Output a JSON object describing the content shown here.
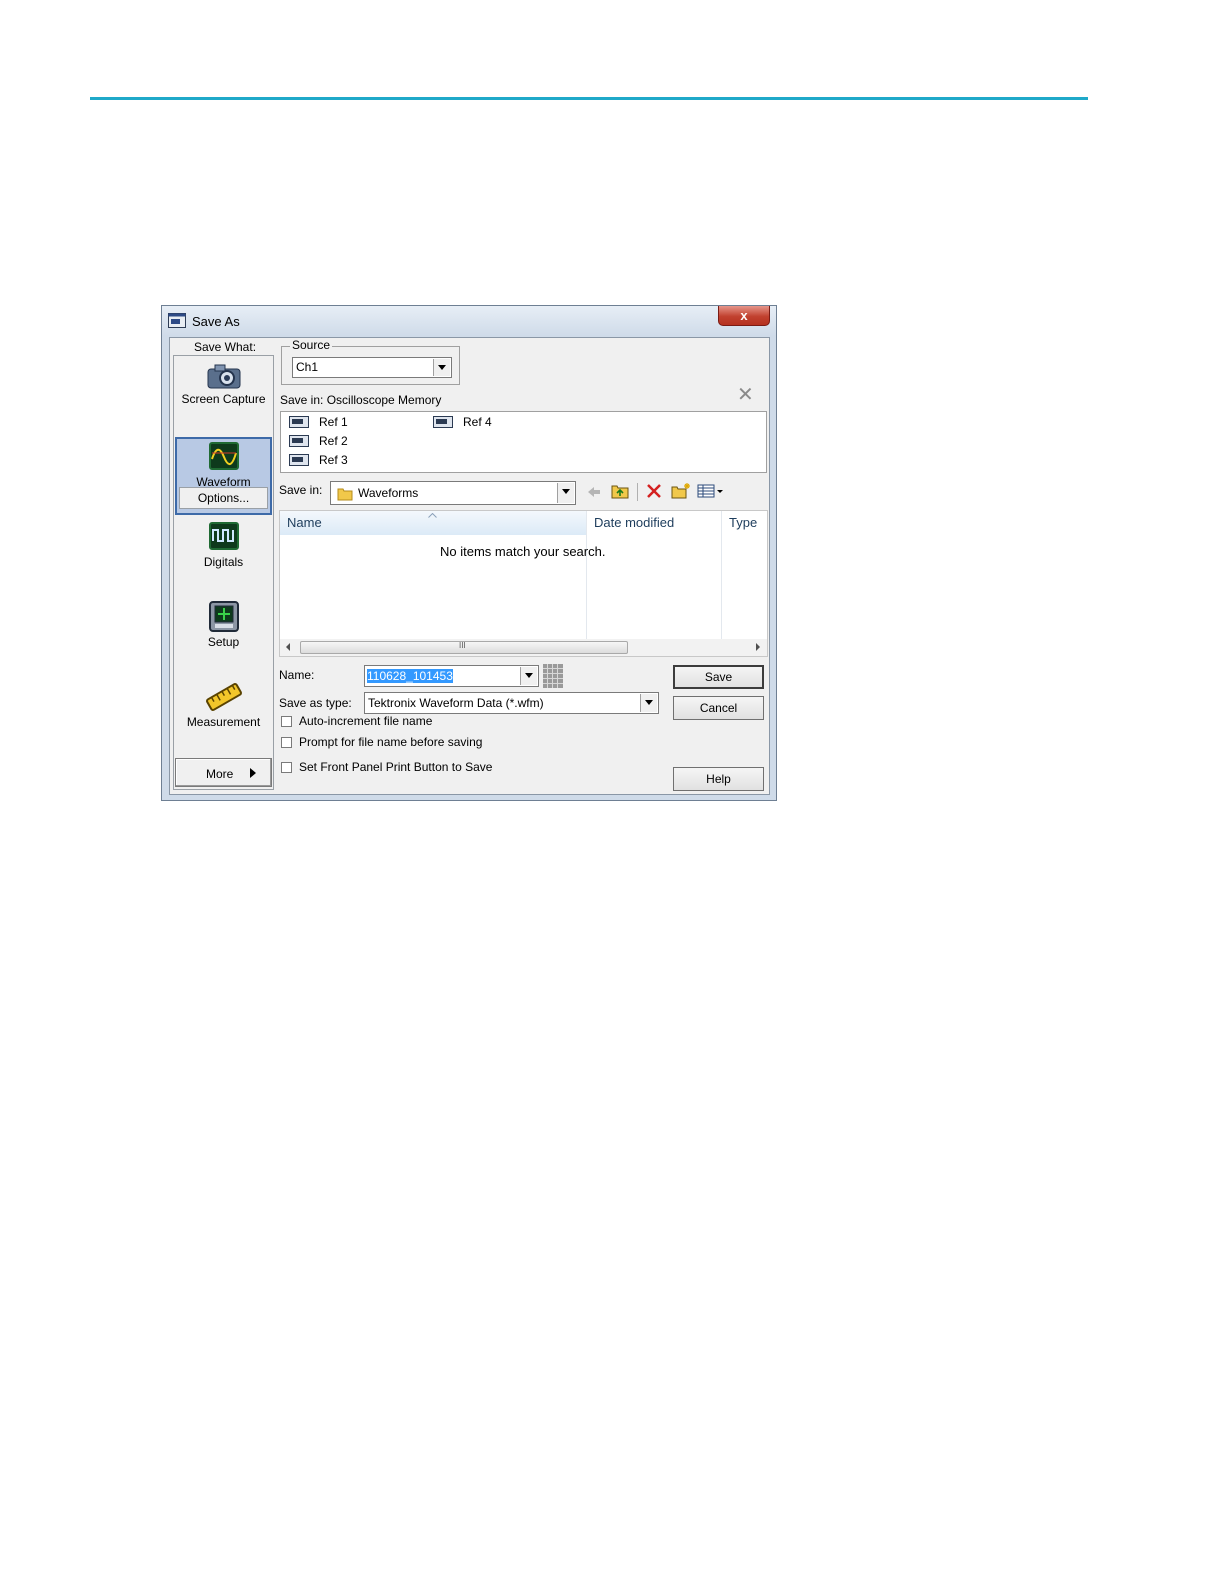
{
  "window": {
    "title": "Save As",
    "close_label": "x"
  },
  "save_what": {
    "label": "Save What:",
    "items": [
      {
        "label": "Screen Capture",
        "icon": "camera-icon"
      },
      {
        "label": "Waveform",
        "icon": "waveform-icon",
        "selected": true
      },
      {
        "label": "Digitals",
        "icon": "digitals-icon"
      },
      {
        "label": "Setup",
        "icon": "setup-icon"
      },
      {
        "label": "Measurement",
        "icon": "measurement-icon"
      }
    ],
    "options_label": "Options...",
    "more_label": "More"
  },
  "source": {
    "label": "Source",
    "value": "Ch1"
  },
  "memory": {
    "label": "Save in: Oscilloscope Memory",
    "refs": [
      "Ref 1",
      "Ref 2",
      "Ref 3",
      "Ref 4"
    ]
  },
  "folder": {
    "label": "Save in:",
    "value": "Waveforms"
  },
  "file_list": {
    "columns": [
      "Name",
      "Date modified",
      "Type"
    ],
    "empty_message": "No items match your search.",
    "scroll_glyph": "III"
  },
  "form": {
    "name_label": "Name:",
    "name_value": "110628_101453",
    "type_label": "Save as type:",
    "type_value": "Tektronix Waveform Data (*.wfm)",
    "checkboxes": [
      {
        "label": "Auto-increment file name",
        "checked": false
      },
      {
        "label": "Prompt for file name before saving",
        "checked": false
      },
      {
        "label": "Set Front Panel Print Button to Save",
        "checked": false
      }
    ]
  },
  "buttons": {
    "save": "Save",
    "cancel": "Cancel",
    "help": "Help"
  },
  "colors": {
    "accent_rule": "#1fa9c9",
    "selection": "#3399ff",
    "close_button": "#c1412f"
  }
}
